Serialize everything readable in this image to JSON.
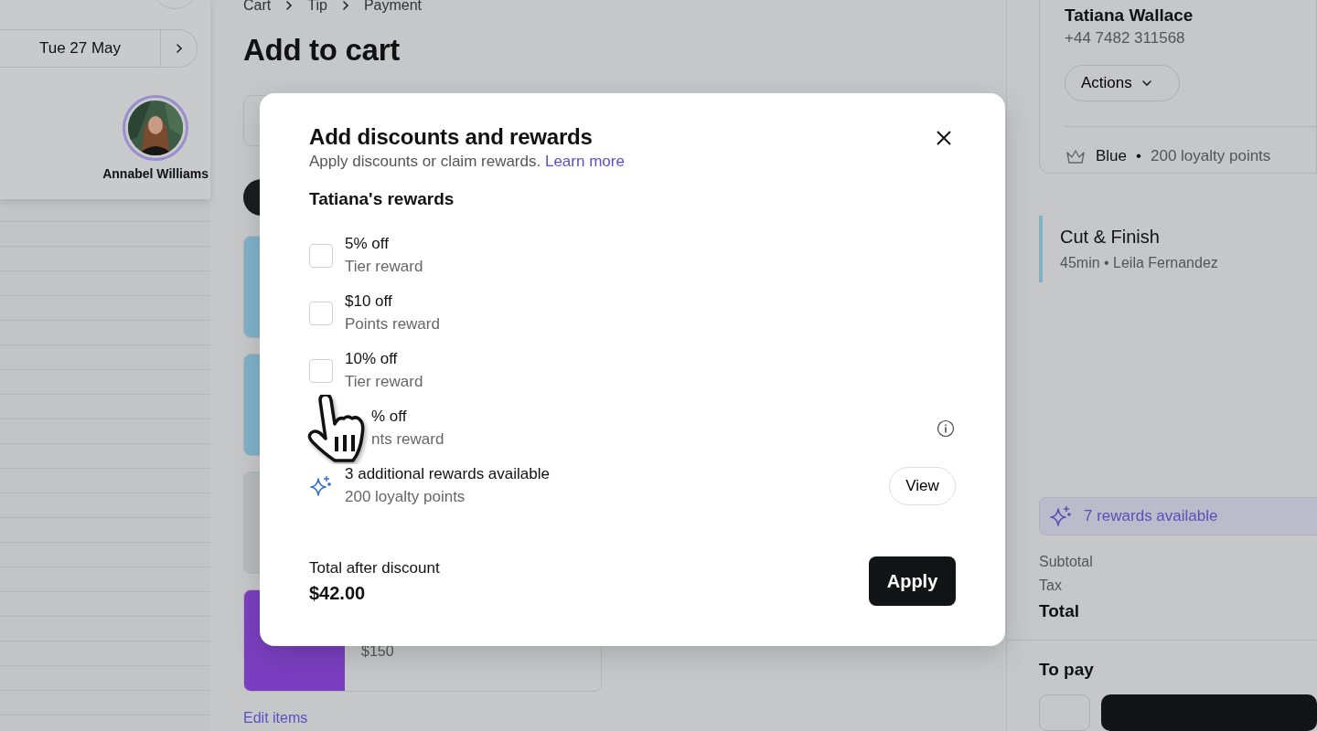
{
  "sidebar": {
    "date": "Tue 27 May",
    "staff": [
      {
        "name": "Annabel Williams",
        "selected": true
      }
    ]
  },
  "breadcrumb": [
    "Cart",
    "Tip",
    "Payment"
  ],
  "title": "Add to cart",
  "cart_items": [
    {
      "kind": "service",
      "color": "#7fb1c9"
    },
    {
      "kind": "service",
      "color": "#7fb1c9"
    },
    {
      "kind": "service",
      "color": "#b8b9bb"
    },
    {
      "kind": "voucher",
      "color": "#7a3fc0",
      "price": "$150"
    }
  ],
  "edit_link": "Edit items",
  "client": {
    "name": "Tatiana Wallace",
    "phone": "+44 7482 311568",
    "actions": "Actions",
    "tier": "Blue",
    "separator": "•",
    "points": "200 loyalty points"
  },
  "services": [
    {
      "name": "Cut & Finish",
      "detail": "45min • Leila Fernandez",
      "color": "#7fb1c9"
    }
  ],
  "rewards_banner": "7 rewards available",
  "summary": [
    {
      "kind": "line",
      "label": "Subtotal"
    },
    {
      "kind": "line",
      "label": "Tax"
    },
    {
      "kind": "total",
      "label": "Total"
    }
  ],
  "to_pay": "To pay",
  "modal": {
    "title": "Add discounts and rewards",
    "subtitle": "Apply discounts or claim rewards.",
    "link": "Learn more",
    "section": "Tatiana's rewards",
    "rewards": [
      {
        "kind": "checkbox",
        "title": "5% off",
        "type": "Tier reward",
        "checked": false,
        "info": false
      },
      {
        "kind": "checkbox",
        "title": "$10 off",
        "type": "Points reward",
        "checked": false,
        "info": false
      },
      {
        "kind": "checkbox",
        "title": "10% off",
        "type": "Tier reward",
        "checked": false,
        "info": false
      },
      {
        "kind": "covered",
        "title": "% off",
        "type": "nts reward",
        "info": true
      }
    ],
    "more": {
      "title": "3 additional rewards available",
      "detail": "200 loyalty points",
      "button": "View"
    },
    "total_label": "Total after discount",
    "total": "$42.00",
    "apply": "Apply"
  }
}
